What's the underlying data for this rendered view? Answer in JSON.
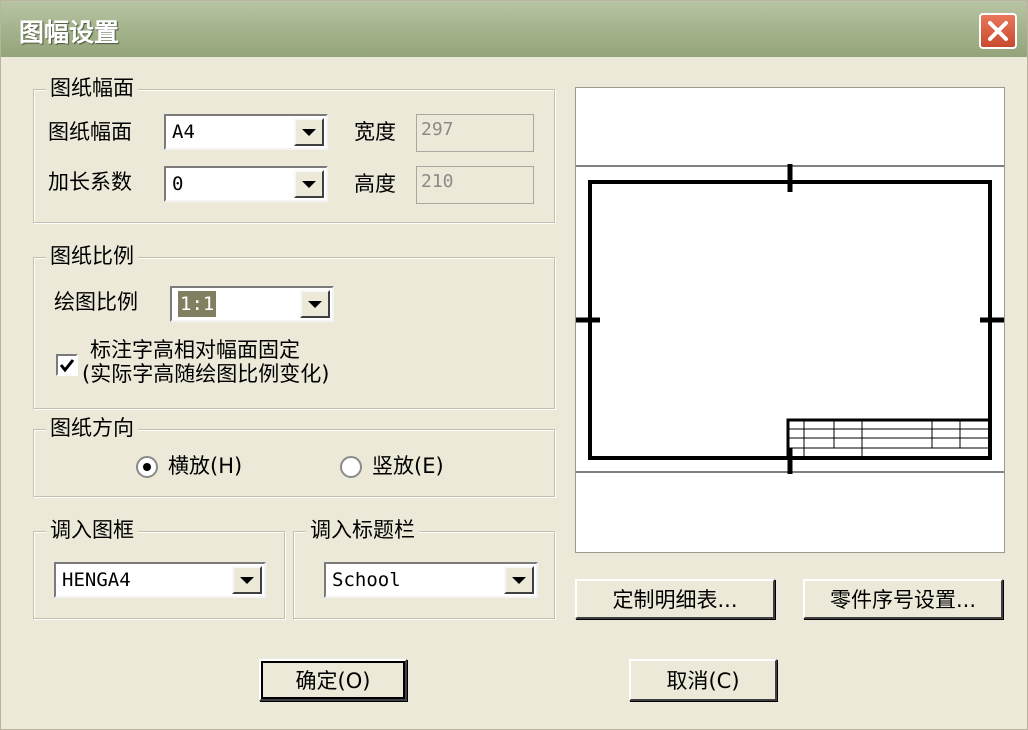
{
  "window": {
    "title": "图幅设置"
  },
  "paper_size_group": {
    "legend": "图纸幅面",
    "size_label": "图纸幅面",
    "size_value": "A4",
    "extend_label": "加长系数",
    "extend_value": "0",
    "width_label": "宽度",
    "width_value": "297",
    "height_label": "高度",
    "height_value": "210"
  },
  "scale_group": {
    "legend": "图纸比例",
    "scale_label": "绘图比例",
    "scale_value": "1:1",
    "checkbox_line1": "标注字高相对幅面固定",
    "checkbox_line2": "(实际字高随绘图比例变化)",
    "checkbox_checked": true
  },
  "orientation_group": {
    "legend": "图纸方向",
    "landscape_label": "横放(H)",
    "portrait_label": "竖放(E)",
    "selected": "landscape"
  },
  "frame_group": {
    "legend": "调入图框",
    "value": "HENGA4"
  },
  "titleblock_group": {
    "legend": "调入标题栏",
    "value": "School"
  },
  "buttons": {
    "custom_table": "定制明细表...",
    "part_number": "零件序号设置...",
    "ok": "确定(O)",
    "cancel": "取消(C)"
  },
  "icons": {
    "close": "close-icon",
    "dropdown": "chevron-down-icon",
    "check": "check-icon"
  }
}
